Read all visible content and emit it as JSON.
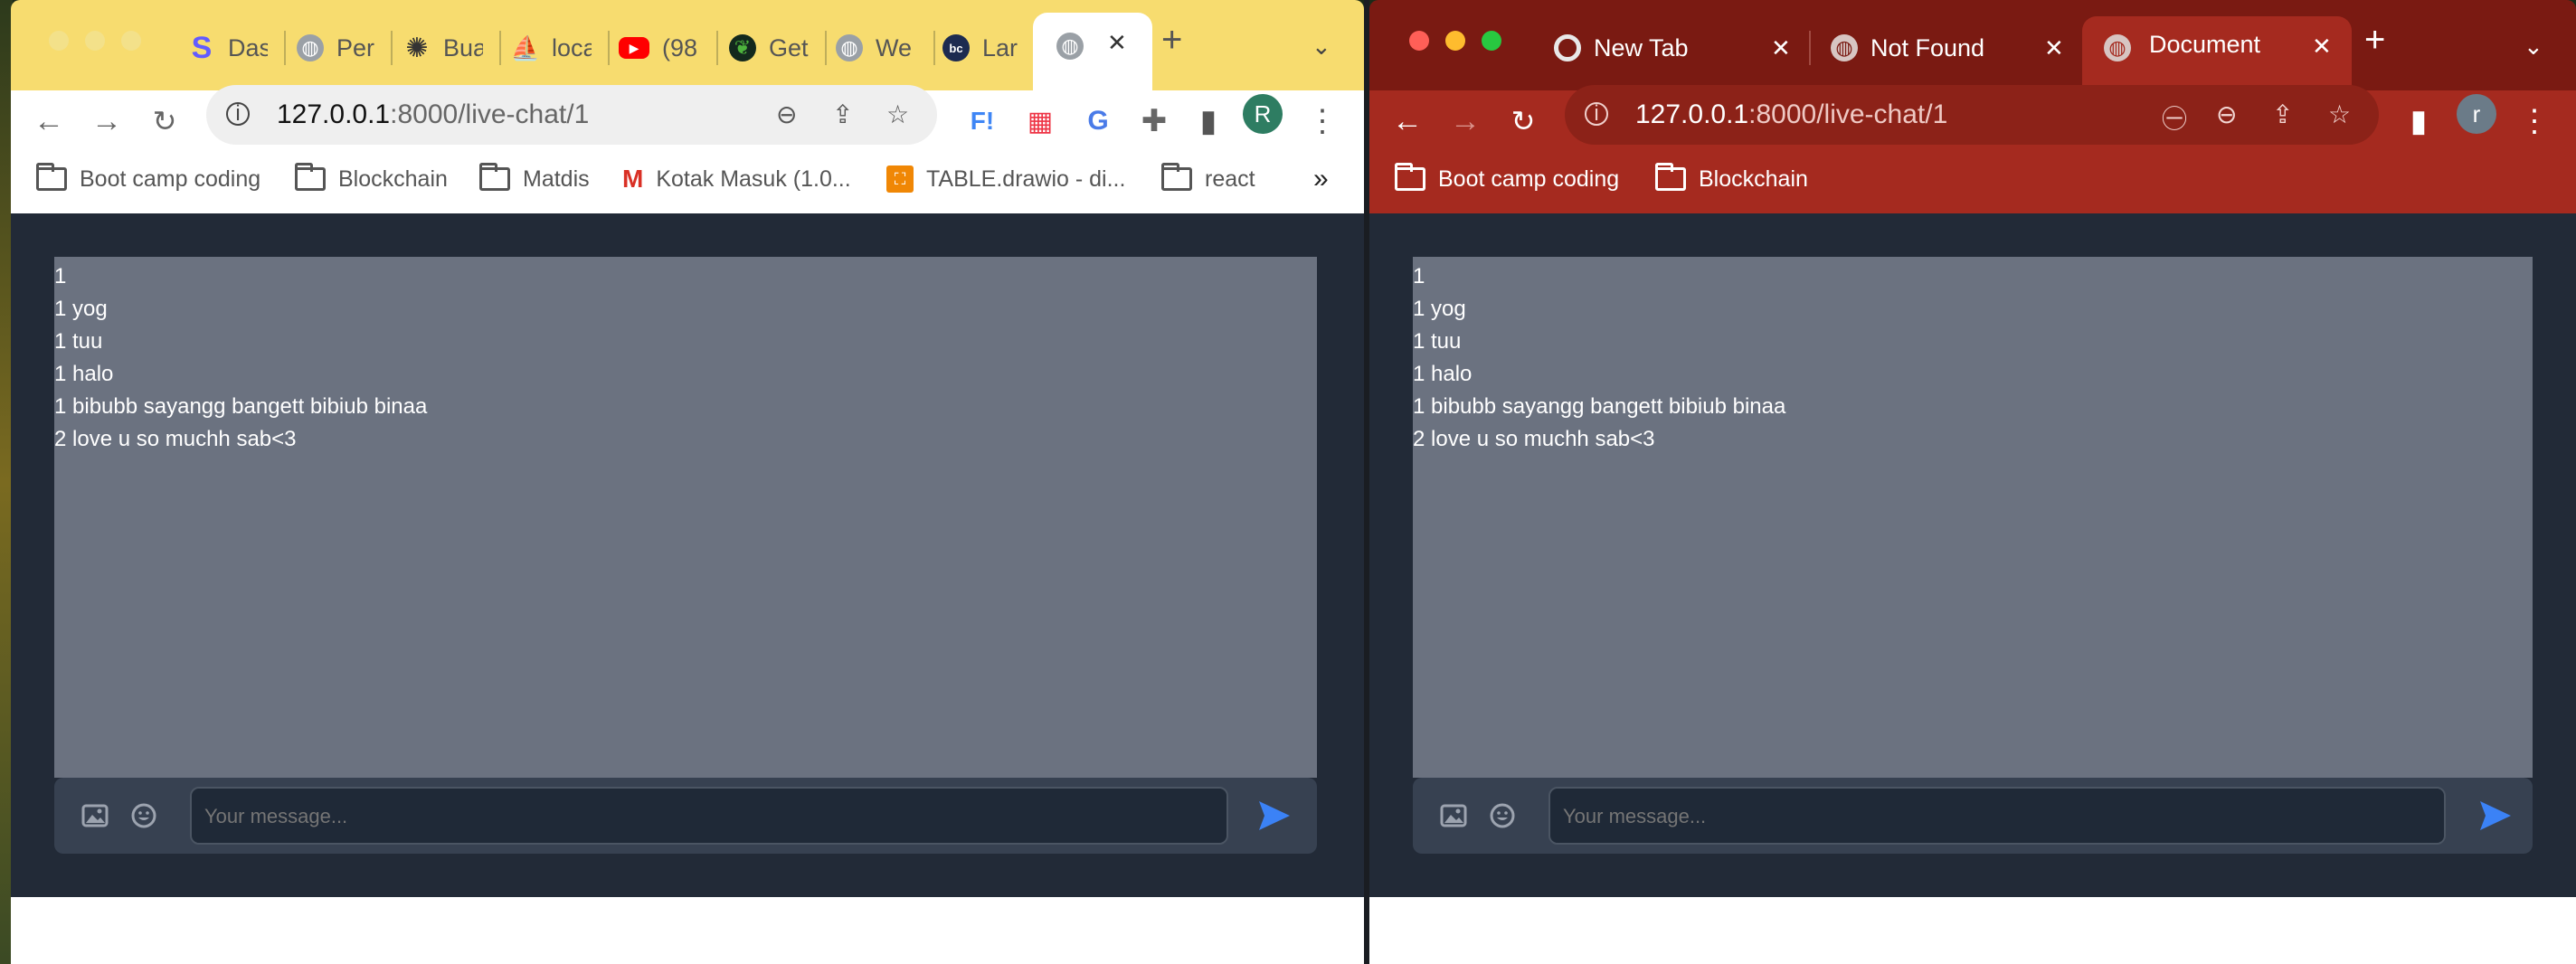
{
  "left_window": {
    "tabs": [
      {
        "title": "Das",
        "icon": "stripe-icon"
      },
      {
        "title": "Per",
        "icon": "globe-icon"
      },
      {
        "title": "Bua",
        "icon": "openai-icon"
      },
      {
        "title": "loca",
        "icon": "phpmyadmin-icon"
      },
      {
        "title": "(98",
        "icon": "youtube-icon"
      },
      {
        "title": "Get",
        "icon": "mongodb-icon"
      },
      {
        "title": "We",
        "icon": "globe-icon"
      },
      {
        "title": "Lar",
        "icon": "laracasts-icon"
      }
    ],
    "url_host": "127.0.0.1",
    "url_path": ":8000/live-chat/1",
    "avatar_letter": "R",
    "bookmarks": [
      {
        "label": "Boot camp coding",
        "icon": "folder-icon"
      },
      {
        "label": "Blockchain",
        "icon": "folder-icon"
      },
      {
        "label": "Matdis",
        "icon": "folder-icon"
      },
      {
        "label": "Kotak Masuk (1.0...",
        "icon": "gmail-icon"
      },
      {
        "label": "TABLE.drawio - di...",
        "icon": "drawio-icon"
      },
      {
        "label": "react",
        "icon": "folder-icon"
      }
    ],
    "overflow": "»",
    "colors": {
      "frame": "#f7dc6f",
      "toolbar": "#ffffff",
      "omnibox": "#f0f0f2",
      "text": "#333333"
    }
  },
  "right_window": {
    "tabs": [
      {
        "title": "New Tab",
        "icon": "chrome-icon"
      },
      {
        "title": "Not Found",
        "icon": "globe-icon"
      },
      {
        "title": "Document",
        "icon": "globe-icon"
      }
    ],
    "url_host": "127.0.0.1",
    "url_path": ":8000/live-chat/1",
    "avatar_letter": "r",
    "bookmarks": [
      {
        "label": "Boot camp coding",
        "icon": "folder-icon"
      },
      {
        "label": "Blockchain",
        "icon": "folder-icon"
      }
    ],
    "colors": {
      "frame": "#7a1a12",
      "toolbar": "#a52a1f",
      "omnibox": "#8a2018",
      "text": "#ffffff"
    }
  },
  "chat": {
    "messages": [
      "1",
      "1 yog",
      "1 tuu",
      "1 halo",
      "1 bibubb sayangg bangett bibiub binaa",
      "2 love u so muchh sab<3"
    ],
    "input_placeholder": "Your message...",
    "colors": {
      "page_bg": "#222a37",
      "messages_bg": "#6b7280",
      "bar_bg": "#374151",
      "input_bg": "#1f2937",
      "send": "#3b82f6"
    }
  }
}
